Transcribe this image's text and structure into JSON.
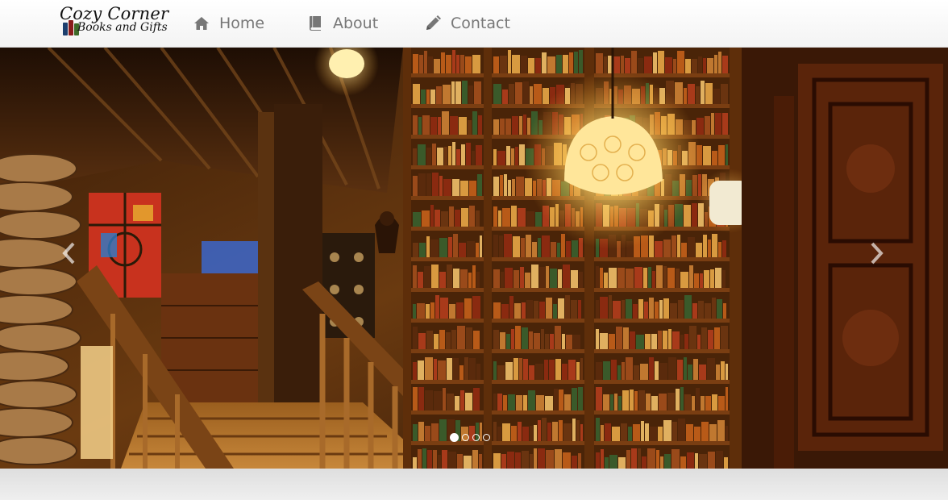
{
  "brand": {
    "line1": "Cozy Corner",
    "line2": "Books and Gifts",
    "icon": "books-icon"
  },
  "nav": {
    "items": [
      {
        "label": "Home",
        "icon": "home-icon"
      },
      {
        "label": "About",
        "icon": "book-icon"
      },
      {
        "label": "Contact",
        "icon": "pencil-icon"
      }
    ]
  },
  "carousel": {
    "slide_image": "bookshop-library-interior-photo",
    "prev_icon": "chevron-left-icon",
    "next_icon": "chevron-right-icon",
    "slide_count": 4,
    "active_slide": 1
  },
  "colors": {
    "nav_text": "#777777",
    "accent_warm": "#e8a030",
    "indicator": "#ffffff"
  }
}
